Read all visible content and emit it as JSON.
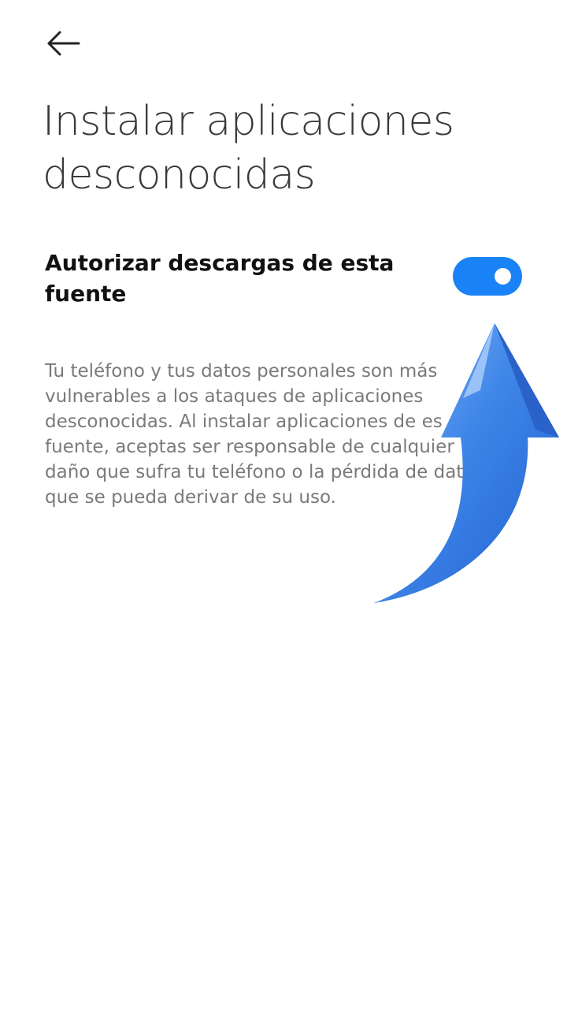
{
  "header": {
    "back_icon": "arrow-left-icon"
  },
  "page": {
    "title": "Instalar aplicaciones desconocidas"
  },
  "setting": {
    "label": "Autorizar descargas de esta fuente",
    "enabled": true
  },
  "description": {
    "text": "Tu teléfono y tus datos personales son más\nvulnerables a los ataques de aplicaciones\ndesconocidas. Al instalar aplicaciones de es\nfuente, aceptas ser responsable de cualquier\ndaño que sufra tu teléfono o la pérdida de dat\nque se pueda derivar de su uso."
  },
  "colors": {
    "toggle_on": "#1a82f7",
    "title": "#3a3a3a",
    "description": "#7a7a7a",
    "arrow": "#3f86e8"
  },
  "overlay": {
    "arrow_icon": "curved-up-arrow-icon"
  }
}
